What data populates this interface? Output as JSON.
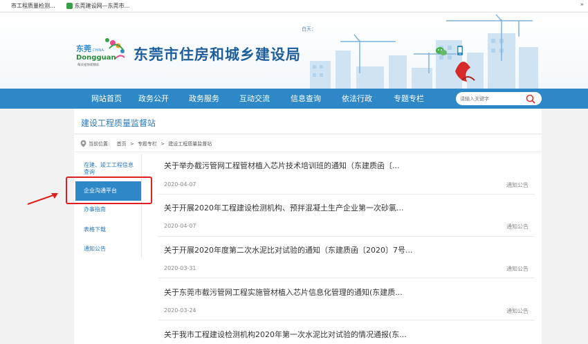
{
  "bookmarks": [
    {
      "label": "市工程质量检测...",
      "icon": "page-icon"
    },
    {
      "label": "东莞建设网—东莞市...",
      "icon": "green-site-icon"
    }
  ],
  "header": {
    "logo_top": "东莞",
    "logo_china": "CHINA",
    "logo_en": "Dongguan",
    "logo_slogan": "每天给你新精彩",
    "site_title": "东莞市住房和城乡建设局",
    "weather_label": "白天："
  },
  "nav": {
    "items": [
      "网站首页",
      "政务公开",
      "政务服务",
      "互动交流",
      "信息查询",
      "依法行政",
      "专题专栏"
    ],
    "search_placeholder": "请输入关键字"
  },
  "page": {
    "station_title": "建设工程质量监督站",
    "breadcrumb_label": "当前位置:",
    "breadcrumb": [
      "首页",
      "专题专栏",
      "建设工程质量监督站"
    ]
  },
  "sidebar": {
    "items": [
      {
        "label_line1": "在建、竣工工程信息",
        "label_line2": "查询"
      },
      {
        "label": "企业沟通平台",
        "active": true
      },
      {
        "label": "办事指南"
      },
      {
        "label": "表格下载"
      },
      {
        "label": "通知公告"
      }
    ]
  },
  "news": [
    {
      "title": "关于举办截污管网工程管材植入芯片技术培训班的通知（东建质函〔...",
      "date": "2020-04-07",
      "category": "通知公告"
    },
    {
      "title": "关于开展2020年工程建设检测机构、预拌混凝土生产企业第一次砂氯...",
      "date": "2020-04-07",
      "category": "通知公告"
    },
    {
      "title": "关于开展2020年度第二次水泥比对试验的通知（东建质函〔2020〕7号...",
      "date": "2020-03-31",
      "category": "通知公告"
    },
    {
      "title": "关于东莞市截污管网工程实施管材植入芯片信息化管理的通知(东建质...",
      "date": "2020-03-24",
      "category": "通知公告"
    },
    {
      "title": "关于我市工程建设检测机构2020年第一次水泥比对试验的情况通报(东...",
      "date": "",
      "category": ""
    }
  ],
  "colors": {
    "nav_blue": "#2e88c8",
    "title_blue": "#1f5e9a",
    "highlight_red": "#e02020"
  }
}
